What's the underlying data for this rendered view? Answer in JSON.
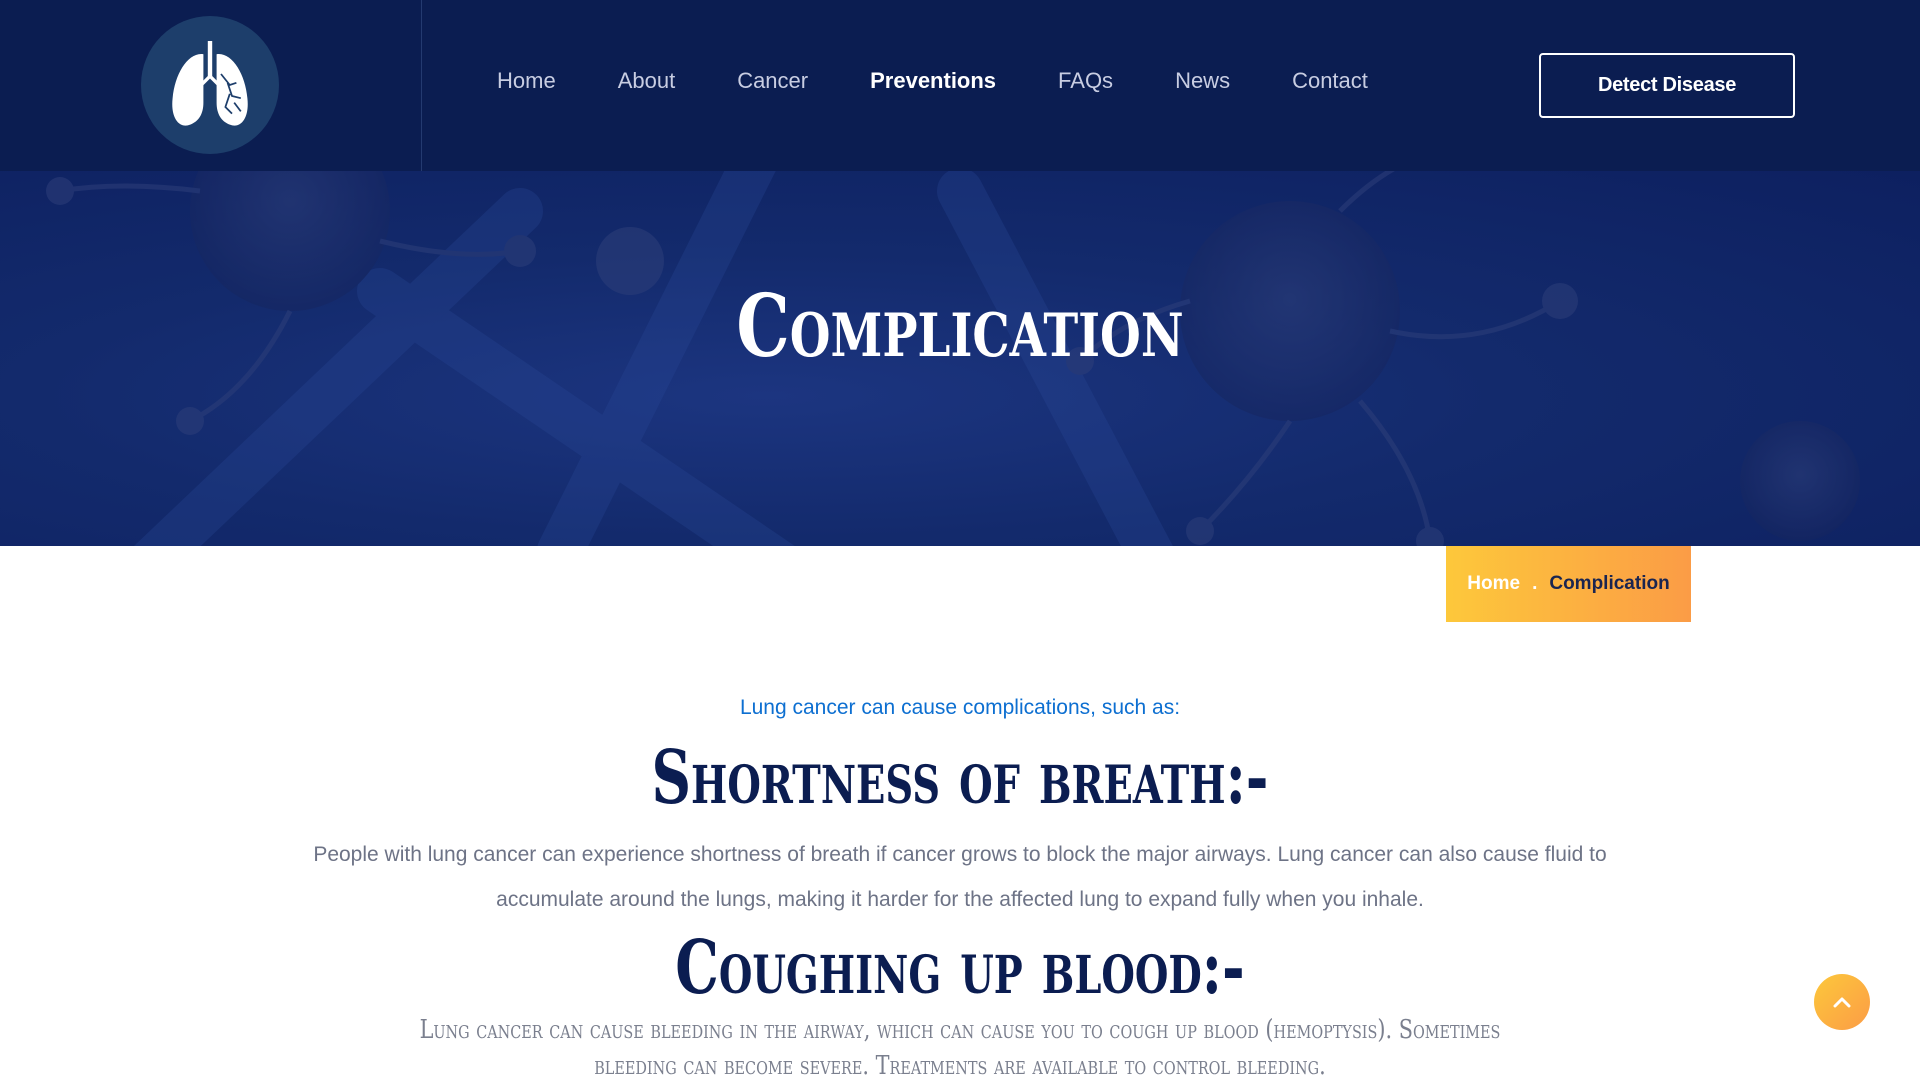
{
  "header": {
    "logo_icon": "lungs-icon",
    "nav": [
      {
        "label": "Home",
        "active": false
      },
      {
        "label": "About",
        "active": false
      },
      {
        "label": "Cancer",
        "active": false
      },
      {
        "label": "Preventions",
        "active": true
      },
      {
        "label": "FAQs",
        "active": false
      },
      {
        "label": "News",
        "active": false
      },
      {
        "label": "Contact",
        "active": false
      }
    ],
    "cta_label": "Detect Disease"
  },
  "hero": {
    "title": "Complication"
  },
  "breadcrumb": {
    "home": "Home",
    "separator": ".",
    "current": "Complication"
  },
  "main": {
    "intro": "Lung cancer can cause complications, such as:",
    "sections": [
      {
        "heading": "Shortness of breath:-",
        "body": "People with lung cancer can experience shortness of breath if cancer grows to block the major airways. Lung cancer can also cause fluid to accumulate around the lungs, making it harder for the affected lung to expand fully when you inhale."
      },
      {
        "heading": "Coughing up blood:-",
        "body": "Lung cancer can cause bleeding in the airway, which can cause you to cough up blood (hemoptysis). Sometimes bleeding can become severe. Treatments are available to control bleeding."
      }
    ]
  },
  "scroll_top_icon": "chevron-up-icon",
  "colors": {
    "navy": "#0b1d51",
    "accent_blue": "#0d6fd1",
    "gradient_start": "#fdc83b",
    "gradient_end": "#fb9c46"
  }
}
